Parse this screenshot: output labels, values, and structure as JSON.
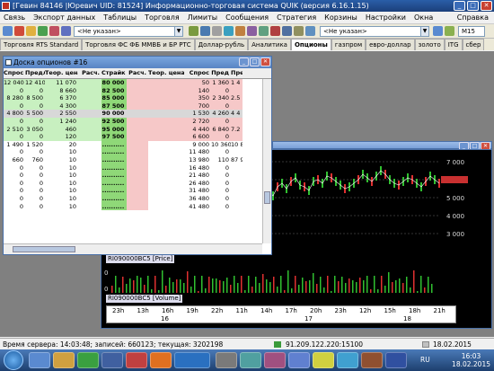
{
  "window": {
    "title": "[Гевин 84146 |Юревич UID: 81524] Информационно-торговая система QUIK (версия 6.16.1.15)"
  },
  "menu": {
    "items": [
      "Связь",
      "Экспорт данных",
      "Таблицы",
      "Торговля",
      "Лимиты",
      "Сообщения",
      "Стратегия",
      "Корзины",
      "Настройки",
      "Окна"
    ],
    "help": "Справка"
  },
  "toolbar": {
    "combo1": "<Не указан>",
    "combo2": "<Не указан>",
    "timeframe": "M15"
  },
  "tabs": [
    {
      "label": "Торговля RTS Standard",
      "active": false
    },
    {
      "label": "Торговля ФС ФБ ММВБ и БР РТС",
      "active": false
    },
    {
      "label": "Доллар-рубль",
      "active": false
    },
    {
      "label": "Аналитика",
      "active": false
    },
    {
      "label": "Опционы",
      "active": true
    },
    {
      "label": "газпром",
      "active": false
    },
    {
      "label": "евро-доллар",
      "active": false
    },
    {
      "label": "золото",
      "active": false
    },
    {
      "label": "ITG",
      "active": false
    },
    {
      "label": "сбер",
      "active": false
    }
  ],
  "options": {
    "title": "Доска опционов #16",
    "headers": [
      "Спрос",
      "Предл",
      "Теор. цена",
      "Расч.",
      "Страйк",
      "Расч.",
      "Теор. цена",
      "Спрос",
      "Пред",
      "Пре"
    ],
    "rows": [
      [
        "12 040",
        "12 410",
        "11 070",
        "",
        "80 000",
        "",
        "50",
        "1 360",
        "1 4"
      ],
      [
        "0",
        "0",
        "8 660",
        "",
        "82 500",
        "",
        "140",
        "0",
        ""
      ],
      [
        "8 280",
        "8 500",
        "6 370",
        "",
        "85 000",
        "",
        "350",
        "2 340",
        "2.5"
      ],
      [
        "0",
        "0",
        "4 300",
        "",
        "87 500",
        "",
        "700",
        "0",
        ""
      ],
      [
        "4 800",
        "5 500",
        "2 550",
        "",
        "90 000",
        "",
        "1 530",
        "4 260",
        "4 4"
      ],
      [
        "0",
        "0",
        "1 240",
        "",
        "92 500",
        "",
        "2 720",
        "0",
        ""
      ],
      [
        "2 510",
        "3 050",
        "460",
        "",
        "95 000",
        "",
        "4 440",
        "6 840",
        "7.2"
      ],
      [
        "0",
        "0",
        "120",
        "",
        "97 500",
        "",
        "6 600",
        "0",
        ""
      ],
      [
        "1 490",
        "1 520",
        "20",
        "",
        "..........",
        "",
        "9 000",
        "10 360",
        "10 8"
      ],
      [
        "0",
        "0",
        "10",
        "",
        "..........",
        "",
        "11 480",
        "0",
        ""
      ],
      [
        "660",
        "760",
        "10",
        "",
        "..........",
        "",
        "13 980",
        "110",
        "87 9"
      ],
      [
        "0",
        "0",
        "10",
        "",
        "..........",
        "",
        "16 480",
        "0",
        ""
      ],
      [
        "0",
        "0",
        "10",
        "",
        "..........",
        "",
        "21 480",
        "0",
        ""
      ],
      [
        "0",
        "0",
        "10",
        "",
        "..........",
        "",
        "26 480",
        "0",
        ""
      ],
      [
        "0",
        "0",
        "10",
        "",
        "..........",
        "",
        "31 480",
        "0",
        ""
      ],
      [
        "0",
        "0",
        "10",
        "",
        "..........",
        "",
        "36 480",
        "0",
        ""
      ],
      [
        "0",
        "0",
        "10",
        "",
        "..........",
        "",
        "41 480",
        "0",
        ""
      ]
    ],
    "selected_row": 4
  },
  "chart": {
    "price_label": "RI090000BC5 [Price]",
    "volume_label": "RI090000BC5 [Volume]",
    "y_ticks": [
      "7 000",
      "6 000",
      "5 000",
      "4 000",
      "3 000"
    ],
    "vol_ticks": [
      "0",
      "0"
    ],
    "price_marker": "0",
    "time_hours": [
      "23h",
      "13h",
      "16h",
      "19h",
      "22h",
      "11h",
      "14h",
      "17h",
      "20h",
      "23h",
      "12h",
      "15h",
      "18h",
      "21h"
    ],
    "time_days": [
      "16",
      "17",
      "18"
    ],
    "series": [
      5200,
      5400,
      5100,
      5600,
      5800,
      5500,
      5900,
      6100,
      5700,
      5600,
      5400,
      5900,
      6000,
      5800,
      6200,
      6100,
      5900,
      5700,
      5500,
      5600,
      5800,
      6000,
      6300,
      6100,
      5900,
      6200,
      6500,
      6300,
      6000,
      5800,
      5700,
      5900,
      6100,
      6000,
      5800,
      5600,
      5900,
      6200,
      6000,
      5800
    ]
  },
  "status": {
    "server_time": "Время сервера: 14:03:48; записей: 660123; текущая: 3202198",
    "ip": "91.209.122.220:15100",
    "date": "18.02.2015"
  },
  "taskbar": {
    "clock_time": "16:03",
    "clock_date": "18.02.2015",
    "lang": "RU"
  },
  "colors": {
    "strike_bg": "#8fd878",
    "call_bg": "#c8f0c0",
    "put_bg": "#f6c8c8",
    "price_line": "#ffffff"
  }
}
